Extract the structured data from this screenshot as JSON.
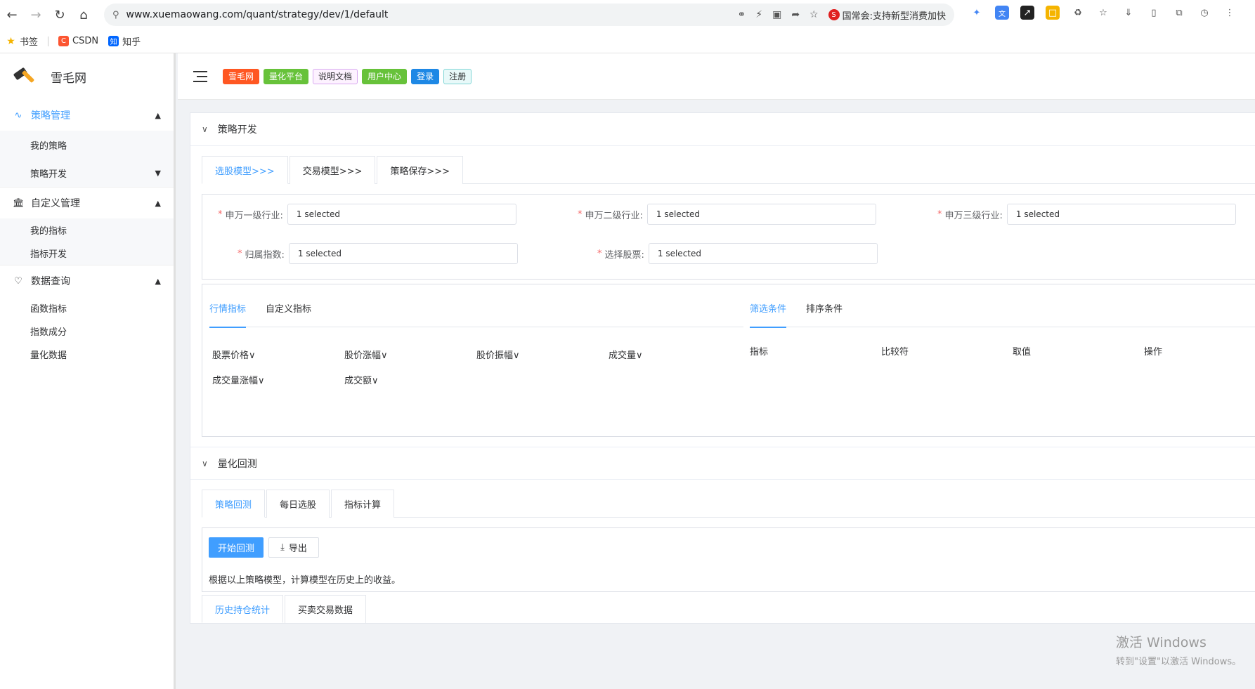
{
  "browser": {
    "url": "www.xuemaowang.com/quant/strategy/dev/1/default",
    "news": "国常会:支持新型消费加快",
    "bookmarks": [
      "书签",
      "CSDN",
      "知乎"
    ]
  },
  "sidebar": {
    "brand": "雪毛网",
    "groups": [
      {
        "label": "策略管理",
        "items": [
          "我的策略",
          "策略开发"
        ]
      },
      {
        "label": "自定义管理",
        "items": [
          "我的指标",
          "指标开发"
        ]
      },
      {
        "label": "数据查询",
        "items": [
          "函数指标",
          "指数成分",
          "量化数据"
        ]
      }
    ]
  },
  "topbar": {
    "tags": [
      {
        "label": "雪毛网",
        "bg": "#ff5722",
        "fg": "#ffffff",
        "border": "#ff5722"
      },
      {
        "label": "量化平台",
        "bg": "#67c23a",
        "fg": "#ffffff",
        "border": "#67c23a"
      },
      {
        "label": "说明文档",
        "bg": "#fdf2ff",
        "fg": "#303133",
        "border": "#d8a8f0"
      },
      {
        "label": "用户中心",
        "bg": "#67c23a",
        "fg": "#ffffff",
        "border": "#67c23a"
      },
      {
        "label": "登录",
        "bg": "#1e88e5",
        "fg": "#ffffff",
        "border": "#1e88e5"
      },
      {
        "label": "注册",
        "bg": "#e8f9f9",
        "fg": "#303133",
        "border": "#7fd6d6"
      }
    ]
  },
  "dev": {
    "title": "策略开发",
    "tabs": [
      "选股模型>>>",
      "交易模型>>>",
      "策略保存>>>"
    ],
    "fields": [
      {
        "label": "申万一级行业:",
        "value": "1 selected"
      },
      {
        "label": "申万二级行业:",
        "value": "1 selected"
      },
      {
        "label": "申万三级行业:",
        "value": "1 selected"
      },
      {
        "label": "归属指数:",
        "value": "1 selected"
      },
      {
        "label": "选择股票:",
        "value": "1 selected"
      }
    ],
    "indicator_tabs": [
      "行情指标",
      "自定义指标"
    ],
    "condition_tabs": [
      "筛选条件",
      "排序条件"
    ],
    "indicators": [
      "股票价格",
      "股价涨幅",
      "股价振幅",
      "成交量",
      "成交量涨幅",
      "成交额"
    ],
    "condition_headers": [
      "指标",
      "比较符",
      "取值",
      "操作"
    ]
  },
  "backtest": {
    "title": "量化回测",
    "tabs": [
      "策略回测",
      "每日选股",
      "指标计算"
    ],
    "start_btn": "开始回测",
    "export_btn": "导出",
    "desc": "根据以上策略模型，计算模型在历史上的收益。",
    "bottom_tabs": [
      "历史持仓统计",
      "买卖交易数据"
    ]
  },
  "watermark": {
    "line1": "激活 Windows",
    "line2": "转到\"设置\"以激活 Windows。"
  }
}
